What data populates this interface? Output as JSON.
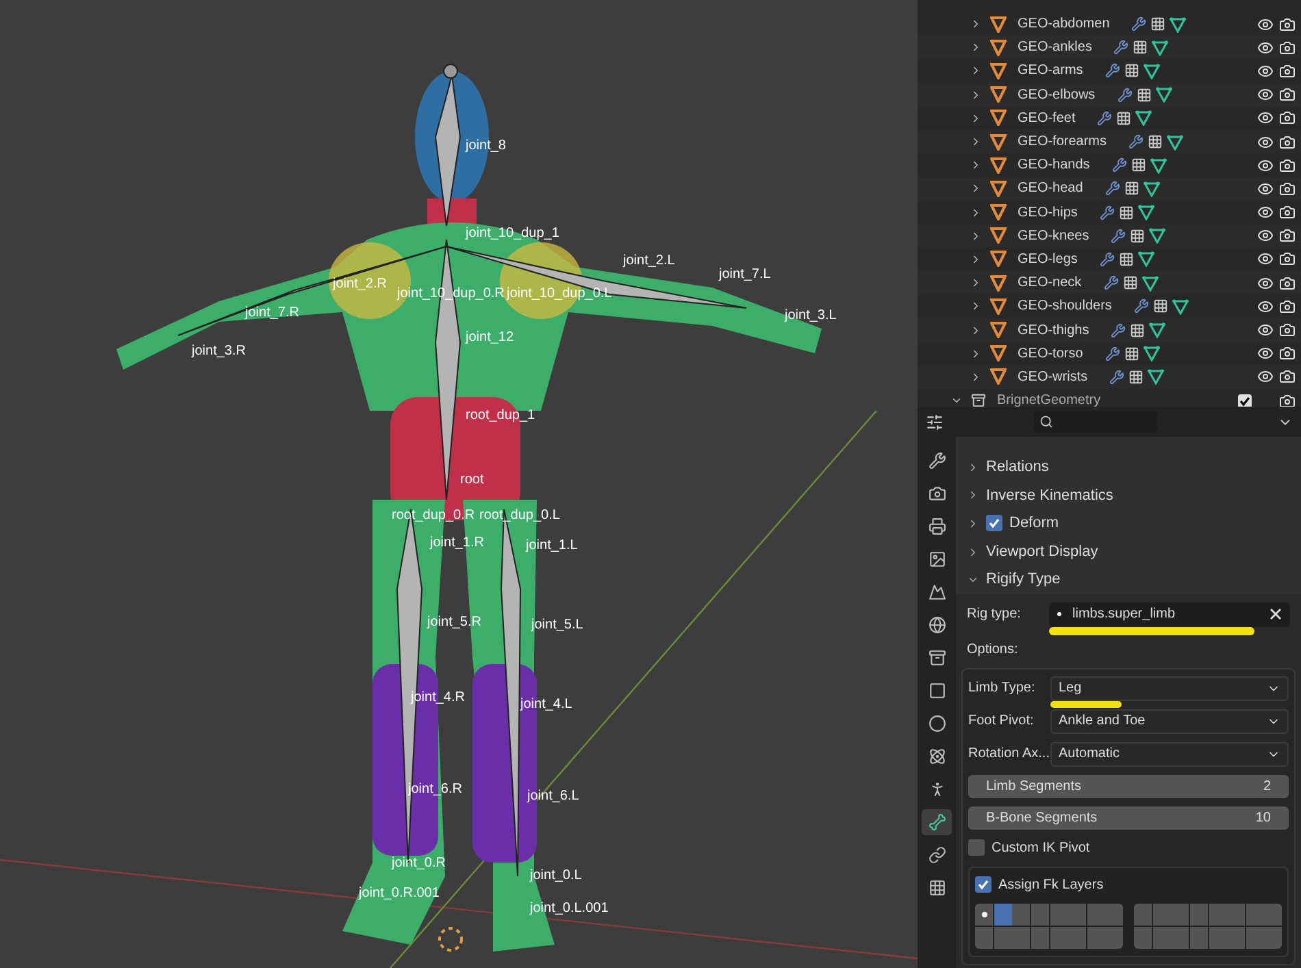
{
  "viewport": {
    "bone_labels": [
      "joint_8",
      "joint_10_dup_1",
      "joint_2.R",
      "joint_10_dup_0.R",
      "joint_10_dup_0.L",
      "joint_2.L",
      "joint_7.R",
      "joint_7.L",
      "joint_3.R",
      "joint_3.L",
      "joint_12",
      "root_dup_1",
      "root",
      "root_dup_0.R",
      "root_dup_0.L",
      "joint_1.R",
      "joint_1.L",
      "joint_5.R",
      "joint_5.L",
      "joint_4.R",
      "joint_4.L",
      "joint_6.R",
      "joint_6.L",
      "joint_0.R",
      "joint_0.L",
      "joint_0.R.001",
      "joint_0.L.001"
    ]
  },
  "outliner": {
    "items": [
      {
        "name": "GEO-abdomen"
      },
      {
        "name": "GEO-ankles"
      },
      {
        "name": "GEO-arms"
      },
      {
        "name": "GEO-elbows"
      },
      {
        "name": "GEO-feet"
      },
      {
        "name": "GEO-forearms"
      },
      {
        "name": "GEO-hands"
      },
      {
        "name": "GEO-head"
      },
      {
        "name": "GEO-hips"
      },
      {
        "name": "GEO-knees"
      },
      {
        "name": "GEO-legs"
      },
      {
        "name": "GEO-neck"
      },
      {
        "name": "GEO-shoulders"
      },
      {
        "name": "GEO-thighs"
      },
      {
        "name": "GEO-torso"
      },
      {
        "name": "GEO-wrists"
      }
    ],
    "collection": {
      "name": "BrignetGeometry",
      "checked": true
    }
  },
  "properties": {
    "tabs": [
      {
        "kind": "tool",
        "selected": false
      },
      {
        "kind": "render",
        "selected": false
      },
      {
        "kind": "output",
        "selected": false
      },
      {
        "kind": "view_layer",
        "selected": false
      },
      {
        "kind": "scene",
        "selected": false
      },
      {
        "kind": "world",
        "selected": false
      },
      {
        "kind": "collection",
        "selected": false
      },
      {
        "kind": "object",
        "selected": false
      },
      {
        "kind": "modifiers",
        "selected": false
      },
      {
        "kind": "physics",
        "selected": false
      },
      {
        "kind": "armature",
        "selected": false
      },
      {
        "kind": "bone",
        "selected": true
      },
      {
        "kind": "constraint",
        "selected": false
      },
      {
        "kind": "texture",
        "selected": false
      }
    ],
    "sections": [
      {
        "label": "Relations",
        "expanded": false
      },
      {
        "label": "Inverse Kinematics",
        "expanded": false
      },
      {
        "label": "Deform",
        "expanded": false,
        "checked": true
      },
      {
        "label": "Viewport Display",
        "expanded": false
      },
      {
        "label": "Rigify Type",
        "expanded": true
      }
    ],
    "rig_type": {
      "label": "Rig type:",
      "value": "limbs.super_limb"
    },
    "options_label": "Options:",
    "dropdowns": [
      {
        "label": "Limb Type:",
        "value": "Leg"
      },
      {
        "label": "Foot Pivot:",
        "value": "Ankle and Toe"
      },
      {
        "label": "Rotation Ax...",
        "value": "Automatic"
      }
    ],
    "sliders": [
      {
        "label": "Limb Segments",
        "value": "2"
      },
      {
        "label": "B-Bone Segments",
        "value": "10"
      }
    ],
    "custom_ik_pivot": {
      "label": "Custom IK Pivot",
      "checked": false
    },
    "fk_layers": {
      "label": "Assign Fk Layers",
      "checked": true,
      "layers": [
        {
          "selected": false,
          "used": true
        },
        {
          "selected": true,
          "used": false
        },
        {
          "selected": false,
          "used": false
        },
        {
          "selected": false,
          "used": false
        },
        {
          "selected": false,
          "used": false
        },
        {
          "selected": false,
          "used": false
        },
        {
          "selected": false,
          "used": false
        },
        {
          "selected": false,
          "used": false
        },
        {
          "selected": false,
          "used": false
        },
        {
          "selected": false,
          "used": false
        },
        {
          "selected": false,
          "used": false
        },
        {
          "selected": false,
          "used": false
        },
        {
          "selected": false,
          "used": false
        },
        {
          "selected": false,
          "used": false
        },
        {
          "selected": false,
          "used": false
        },
        {
          "selected": false,
          "used": false
        },
        {
          "selected": false,
          "used": false
        },
        {
          "selected": false,
          "used": false
        },
        {
          "selected": false,
          "used": false
        },
        {
          "selected": false,
          "used": false
        },
        {
          "selected": false,
          "used": false
        },
        {
          "selected": false,
          "used": false
        },
        {
          "selected": false,
          "used": false
        },
        {
          "selected": false,
          "used": false
        },
        {
          "selected": false,
          "used": false
        },
        {
          "selected": false,
          "used": false
        },
        {
          "selected": false,
          "used": false
        },
        {
          "selected": false,
          "used": false
        },
        {
          "selected": false,
          "used": false
        },
        {
          "selected": false,
          "used": false
        },
        {
          "selected": false,
          "used": false
        },
        {
          "selected": false,
          "used": false
        }
      ]
    }
  }
}
